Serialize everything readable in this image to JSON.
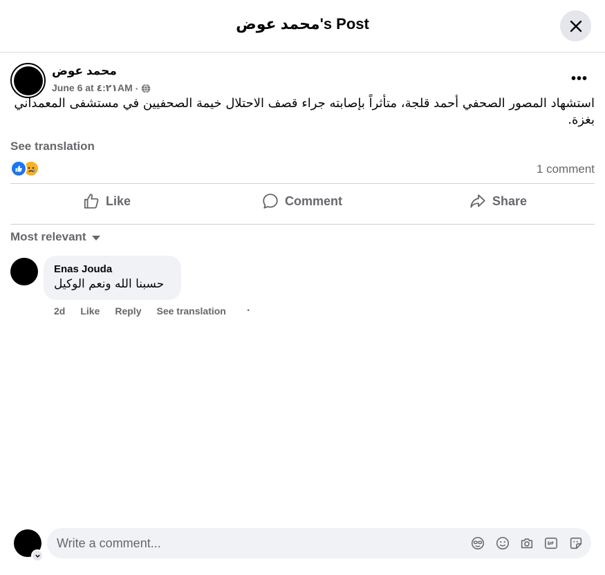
{
  "header": {
    "title": "محمد عوض's Post"
  },
  "post": {
    "author": "محمد عوض",
    "date": "June 6 at ٤:٢١AM",
    "separator": "·",
    "more": "•••",
    "text": "استشهاد المصور الصحفي أحمد قلجة، متأثراً بإصابته جراء قصف الاحتلال خيمة الصحفيين في مستشفى المعمداني بغزة.",
    "see_translation": "See translation",
    "comment_count": "1 comment"
  },
  "actions": {
    "like": "Like",
    "comment": "Comment",
    "share": "Share"
  },
  "comments_sort": "Most relevant",
  "comment": {
    "author": "Enas Jouda",
    "text": "حسبنا الله ونعم الوكيل",
    "time": "2d",
    "like": "Like",
    "reply": "Reply",
    "see_translation": "See translation",
    "dot": "·"
  },
  "composer": {
    "placeholder": "Write a comment..."
  },
  "colors": {
    "like_blue": "#1877f2",
    "sad_yellow": "#f7b125",
    "secondary_text": "#65676b",
    "bubble_bg": "#f0f2f5"
  }
}
